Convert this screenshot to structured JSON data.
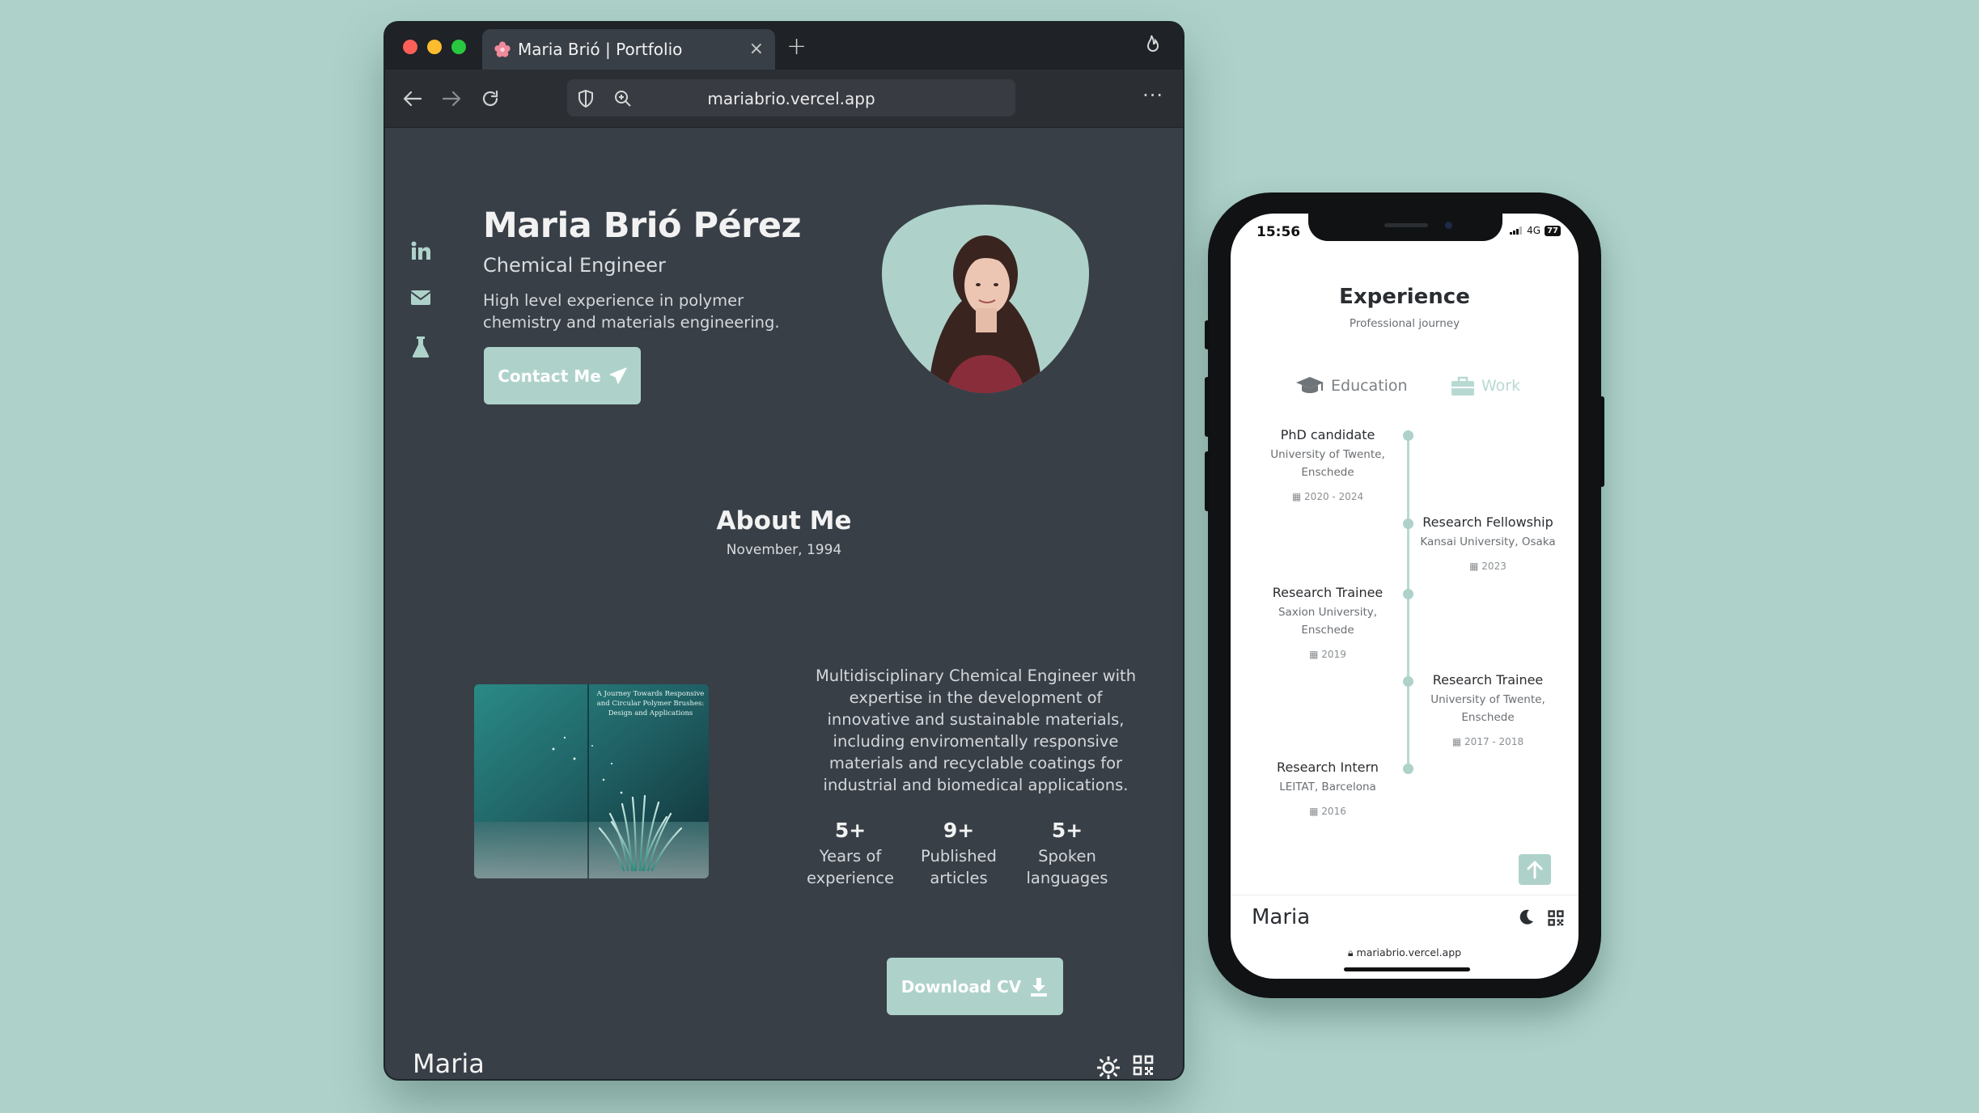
{
  "browser": {
    "tab_title": "Maria Brió | Portfolio",
    "tab_close": "×",
    "new_tab": "+",
    "url": "mariabrio.vercel.app",
    "more": "···"
  },
  "hero": {
    "name": "Maria Brió Pérez",
    "role": "Chemical Engineer",
    "description": "High level experience in polymer chemistry and materials engineering.",
    "contact_label": "Contact Me"
  },
  "about": {
    "title": "About Me",
    "date": "November, 1994",
    "text": "Multidisciplinary Chemical Engineer with expertise in the development of innovative and sustainable materials, including enviromentally responsive materials and recyclable coatings for industrial and biomedical applications.",
    "book_title": "A Journey Towards Responsive and Circular Polymer Brushes: Design and Applications",
    "stats": [
      {
        "num": "5+",
        "label": "Years of experience"
      },
      {
        "num": "9+",
        "label": "Published articles"
      },
      {
        "num": "5+",
        "label": "Spoken languages"
      }
    ],
    "cv_label": "Download CV"
  },
  "footer": {
    "brand": "Maria"
  },
  "phone": {
    "time": "15:56",
    "network": "4G",
    "battery": "77",
    "title": "Experience",
    "subtitle": "Professional journey",
    "tabs": {
      "education": "Education",
      "work": "Work"
    },
    "events": [
      {
        "title": "PhD candidate",
        "org": "University of Twente, Enschede",
        "date": "2020 - 2024"
      },
      {
        "title": "Research Fellowship",
        "org": "Kansai University, Osaka",
        "date": "2023"
      },
      {
        "title": "Research Trainee",
        "org": "Saxion University, Enschede",
        "date": "2019"
      },
      {
        "title": "Research Trainee",
        "org": "University of Twente, Enschede",
        "date": "2017 - 2018"
      },
      {
        "title": "Research Intern",
        "org": "LEITAT, Barcelona",
        "date": "2016"
      }
    ],
    "brand": "Maria",
    "url": "mariabrio.vercel.app"
  },
  "colors": {
    "accent": "#aed2ca",
    "page_bg": "#383f47",
    "desktop_bg": "#aed2ca"
  }
}
